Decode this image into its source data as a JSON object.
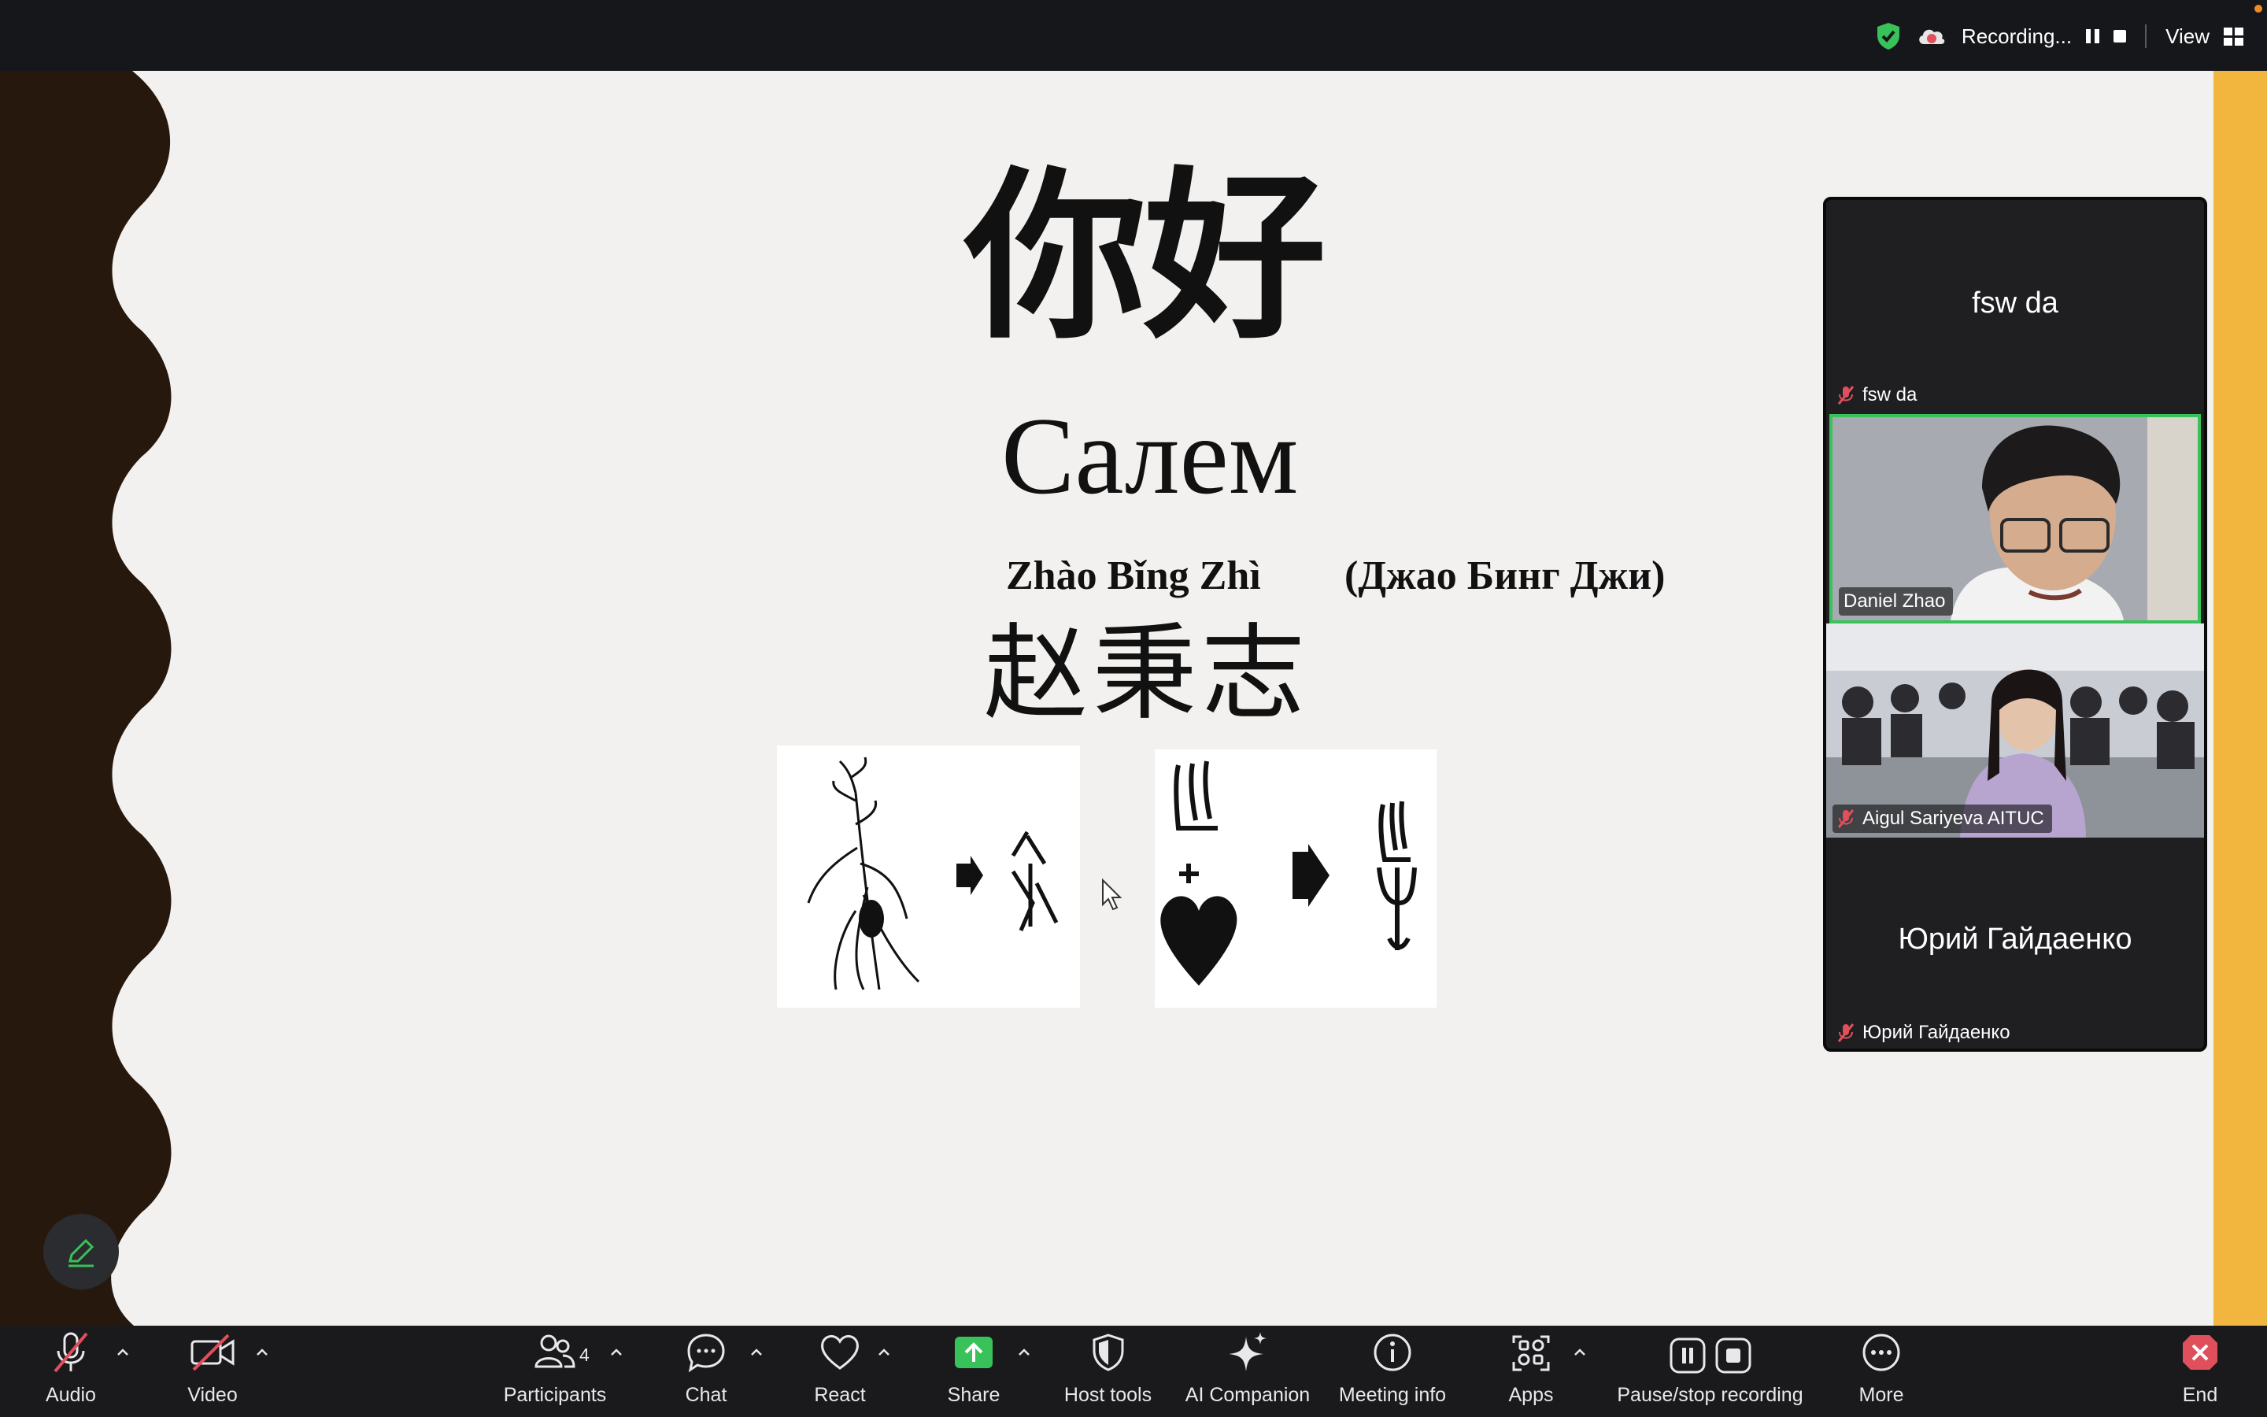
{
  "topbar": {
    "recording_label": "Recording...",
    "view_label": "View",
    "colors": {
      "shield": "#39c15a",
      "rec": "#e0505c",
      "notif": "#f08a24"
    }
  },
  "slide": {
    "greeting_cn": "你好",
    "greeting_kz": "Салем",
    "pinyin": "Zhào Bǐng Zhì",
    "russian": "(Джао Бинг Джи)",
    "name_cn": "赵秉志"
  },
  "participants_panel": {
    "tiles": [
      {
        "name": "fsw da",
        "display": "fsw da",
        "muted": true,
        "video": false
      },
      {
        "name": "Daniel Zhao",
        "muted": false,
        "video": true,
        "active_speaker": true
      },
      {
        "name": "Aigul Sariyeva  AITUC",
        "muted": true,
        "video": true
      },
      {
        "name": "Юрий Гайдаенко",
        "display": "Юрий Гайдаенко",
        "muted": true,
        "video": false
      }
    ]
  },
  "toolbar": {
    "audio": "Audio",
    "video": "Video",
    "participants": "Participants",
    "participants_count": "4",
    "chat": "Chat",
    "react": "React",
    "share": "Share",
    "host_tools": "Host tools",
    "ai_companion": "AI Companion",
    "meeting_info": "Meeting info",
    "apps": "Apps",
    "pause_stop": "Pause/stop recording",
    "more": "More",
    "end": "End",
    "colors": {
      "share": "#39c15a",
      "muted": "#e0505c",
      "end": "#e0505c"
    }
  }
}
